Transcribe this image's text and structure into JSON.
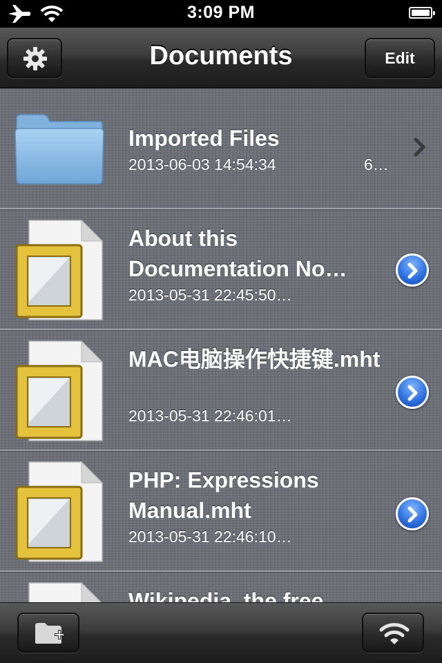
{
  "status_bar": {
    "time": "3:09 PM"
  },
  "nav": {
    "title": "Documents",
    "edit_label": "Edit"
  },
  "rows": [
    {
      "kind": "folder",
      "name": "Imported Files",
      "date": "2013-06-03 14:54:34",
      "extra": "6…",
      "accessory": "chevron"
    },
    {
      "kind": "file",
      "name": "About this Documentation No…",
      "date": "2013-05-31 22:45:50…",
      "accessory": "disclosure"
    },
    {
      "kind": "file",
      "name": "MAC电脑操作快捷键.mht",
      "date": "2013-05-31 22:46:01…",
      "accessory": "disclosure"
    },
    {
      "kind": "file",
      "name": "PHP: Expressions Manual.mht",
      "date": "2013-05-31 22:46:10…",
      "accessory": "disclosure"
    },
    {
      "kind": "file",
      "name": "Wikipedia, the free",
      "accessory": "disclosure"
    }
  ],
  "icons": {
    "status": [
      "airplane-icon",
      "wifi-signal-icon",
      "battery-icon"
    ],
    "nav": [
      "gear-icon"
    ],
    "toolbar": [
      "new-folder-icon",
      "wifi-icon"
    ]
  },
  "colors": {
    "list_background": "#6e727a",
    "separator": "#9ea3aa",
    "disclosure_blue": "#2f73e3",
    "folder_blue": "#8dbde6",
    "frame_gold": "#e4c23c"
  }
}
